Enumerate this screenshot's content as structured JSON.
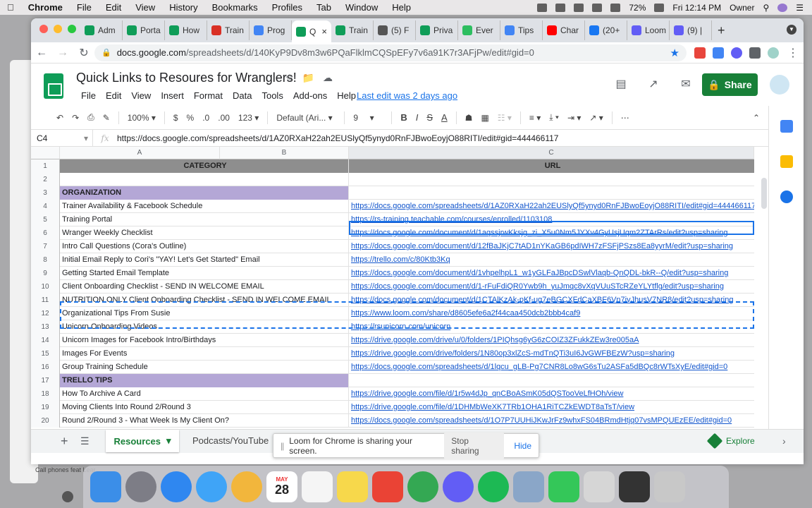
{
  "menubar": {
    "apple": "",
    "items": [
      "Chrome",
      "File",
      "Edit",
      "View",
      "History",
      "Bookmarks",
      "Profiles",
      "Tab",
      "Window",
      "Help"
    ],
    "battery": "72%",
    "clock": "Fri 12:14 PM",
    "user": "Owner"
  },
  "browser": {
    "tabs": [
      {
        "label": "Adm",
        "color": "#0f9d58"
      },
      {
        "label": "Porta",
        "color": "#0f9d58"
      },
      {
        "label": "How",
        "color": "#0f9d58"
      },
      {
        "label": "Train",
        "color": "#d93025"
      },
      {
        "label": "Prog",
        "color": "#4285f4"
      },
      {
        "label": "Q",
        "color": "#0f9d58",
        "active": true
      },
      {
        "label": "Train",
        "color": "#0f9d58"
      },
      {
        "label": "(5) F",
        "color": "#555555"
      },
      {
        "label": "Priva",
        "color": "#0f9d58"
      },
      {
        "label": "Ever",
        "color": "#2dbe60"
      },
      {
        "label": "Tips",
        "color": "#4285f4"
      },
      {
        "label": "Char",
        "color": "#ff0000"
      },
      {
        "label": "(20+",
        "color": "#1877f2"
      },
      {
        "label": "Loom",
        "color": "#625df5"
      },
      {
        "label": "(9) |",
        "color": "#625df5"
      }
    ],
    "url_host": "docs.google.com",
    "url_rest": "/spreadsheets/d/140KyP9Dv8m3w6PQaFlklmCQSpEFy7v6a91K7r3AFjPw/edit#gid=0"
  },
  "doc": {
    "title": "Quick Links to Resoures for Wranglers!",
    "menus": [
      "File",
      "Edit",
      "View",
      "Insert",
      "Format",
      "Data",
      "Tools",
      "Add-ons",
      "Help"
    ],
    "last_edit": "Last edit was 2 days ago",
    "share": "Share"
  },
  "toolbar": {
    "zoom": "100%",
    "currency": "$",
    "percent": "%",
    "dec_less": ".0",
    "dec_more": ".00",
    "format_num": "123",
    "font": "Default (Ari...",
    "size": "9",
    "bold": "B",
    "italic": "I",
    "strike": "S",
    "textcolor": "A"
  },
  "formula": {
    "cell": "C4",
    "fx": "fx",
    "value": "https://docs.google.com/spreadsheets/d/1AZ0RXaH22ah2EUSlyQf5ynyd0RnFJBwoEoyjO88RITI/edit#gid=444466117"
  },
  "grid": {
    "columns": [
      "A",
      "B",
      "C"
    ],
    "rows": [
      {
        "n": "1",
        "a": "CATEGORY",
        "c": "URL",
        "type": "header"
      },
      {
        "n": "2",
        "a": "",
        "c": ""
      },
      {
        "n": "3",
        "a": "ORGANIZATION",
        "c": "",
        "type": "section"
      },
      {
        "n": "4",
        "a": "Trainer Availability & Facebook Schedule",
        "c": "https://docs.google.com/spreadsheets/d/1AZ0RXaH22ah2EUSlyQf5ynyd0RnFJBwoEoyjO88RITI/edit#gid=444466117"
      },
      {
        "n": "5",
        "a": "Training Portal",
        "c": "https://rs-training.teachable.com/courses/enrolled/1103108"
      },
      {
        "n": "6",
        "a": "Wranger Weekly Checklist",
        "c": "https://docs.google.com/document/d/1aqssjrwKksjg_zi_X5u0Nm5JYXv4GyUsjUqm2ZTArRs/edit?usp=sharing"
      },
      {
        "n": "7",
        "a": "Intro Call Questions (Cora's Outline)",
        "c": "https://docs.google.com/document/d/12fBaJKjC7tAD1nYKaGB6pdIWH7zFSFjPSzs8Ea8yyrM/edit?usp=sharing"
      },
      {
        "n": "8",
        "a": "Initial Email Reply to Cori's \"YAY! Let's Get Started\" Email",
        "c": "https://trello.com/c/80Ktb3Kq"
      },
      {
        "n": "9",
        "a": "Getting Started Email Template",
        "c": "https://docs.google.com/document/d/1vhpelhpL1_w1yGLFaJBpcDSwlVlaqb-QnQDL-bkR--Q/edit?usp=sharing"
      },
      {
        "n": "10",
        "a": "Client Onboarding Checklist - SEND IN WELCOME EMAIL",
        "c": "https://docs.google.com/document/d/1-rFuFdiQR0Ywb9h_yuJmqc8vXqVUuSTcRZeYLYtflg/edit?usp=sharing"
      },
      {
        "n": "11",
        "a": "NUTRITION ONLY Client Onboarding Checklist - SEND IN WELCOME EMAIL",
        "c": "https://docs.google.com/document/d/1CTAlKzAk-pKf-ug7eBGCXFdCaXBF6Vn7ivJhusV7NR8/edit?usp=sharing"
      },
      {
        "n": "12",
        "a": "Organizational Tips From Susie",
        "c": "https://www.loom.com/share/d8605efe6a2f44caa450dcb2bbb4caf9"
      },
      {
        "n": "13",
        "a": "Unicorn Onboarding Videos",
        "c": "https://rsunicorn.com/unicorn"
      },
      {
        "n": "14",
        "a": "Unicorn Images for Facebook Intro/Birthdays",
        "c": "https://drive.google.com/drive/u/0/folders/1PIQhsg6yG6zCOIZ3ZFukkZEw3re005aA"
      },
      {
        "n": "15",
        "a": "Images For Events",
        "c": "https://drive.google.com/drive/folders/1N80op3xlZcS-mdTnQTi3uI6JvGWFBEzW?usp=sharing"
      },
      {
        "n": "16",
        "a": "Group Training Schedule",
        "c": "https://docs.google.com/spreadsheets/d/1lqcu_gLB-Pg7CNR8Lo8wG6sTu2ASFa5dBQc8rWTsXyE/edit#gid=0"
      },
      {
        "n": "17",
        "a": "TRELLO TIPS",
        "c": "",
        "type": "section"
      },
      {
        "n": "18",
        "a": "How To Archive A Card",
        "c": "https://drive.google.com/file/d/1r5w4dJp_qnCBoASmK05dQSTooVeLfHOh/view"
      },
      {
        "n": "19",
        "a": "Moving Clients Into Round 2/Round 3",
        "c": "https://drive.google.com/file/d/1DHMbWeXK7TRb1OHA1RiTCZkEWDT8aTsT/view"
      },
      {
        "n": "20",
        "a": "Round 2/Round 3 - What Week Is My Client On?",
        "c": "https://docs.google.com/spreadsheets/d/1O7P7UUHiJKwJrFz9whxFS04BRmdHtjq07vsMPQUEzEE/edit#gid=0"
      }
    ]
  },
  "sheets": {
    "add": "+",
    "tab1": "Resources",
    "tab2": "Podcasts/YouTube",
    "explore": "Explore"
  },
  "loom": {
    "grip": "||",
    "message": "Loom for Chrome is sharing your screen.",
    "stop": "Stop sharing",
    "hide": "Hide"
  },
  "background": {
    "note": "Call phones feat Lear"
  },
  "dock": {
    "calendar_month": "MAY",
    "calendar_day": "28"
  }
}
